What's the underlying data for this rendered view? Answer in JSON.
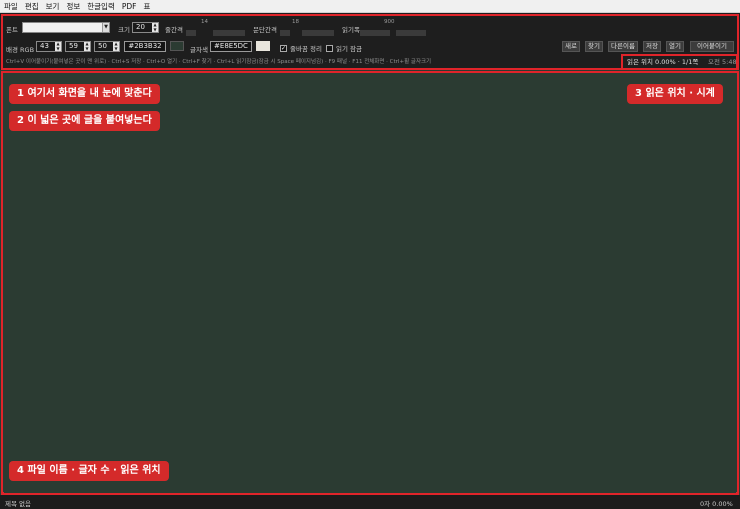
{
  "menu": [
    "파일",
    "편집",
    "보기",
    "정보",
    "한글입력",
    "PDF",
    "표"
  ],
  "toolbar": {
    "font_label": "폰트",
    "size_label": "크기",
    "size_value": "20",
    "line_spacing_label": "줄간격",
    "line_spacing_value": "14",
    "para_spacing_label": "문단간격",
    "para_spacing_value": "18",
    "read_width_label": "읽기폭",
    "read_width_value": "900",
    "bg_rgb_label": "배경 RGB",
    "bg_r": "43",
    "bg_g": "59",
    "bg_b": "50",
    "bg_hex": "#2B3B32",
    "text_color_label": "글자색",
    "text_hex": "#E8E5DC",
    "wrap_label": "줄바꿈 정리",
    "wrap_checked": true,
    "read_lock_label": "읽기 잠금",
    "read_lock_checked": false,
    "buttons": [
      "새로",
      "찾기",
      "다른이름",
      "저장",
      "열기",
      "이어붙이기"
    ],
    "hints": "Ctrl+V 이어붙이기(붙여넣은 곳이 맨 위로) · Ctrl+S 저장 · Ctrl+O 열기 · Ctrl+F 찾기 · Ctrl+L 읽기잠금(잠금 시 Space 페이지넘김) · F9 패널 · F11 전체화면 · Ctrl+휠 글자크기",
    "reading_status": "읽은 위치 0.00%   ·   1/1쪽",
    "clock": "오전 5:48"
  },
  "colors": {
    "background": "#2B3B32",
    "text": "#E8E5DC",
    "annotation": "#D42A2A"
  },
  "annotations": {
    "a1": "1  여기서 화면을 내 눈에 맞춘다",
    "a2": "2  이 넓은 곳에 글을 붙여넣는다",
    "a3": "3  읽은 위치 · 시계",
    "a4": "4  파일 이름 · 글자 수 · 읽은 위치"
  },
  "statusbar": {
    "filename": "제목 없음",
    "count": "0자  0.00%"
  }
}
